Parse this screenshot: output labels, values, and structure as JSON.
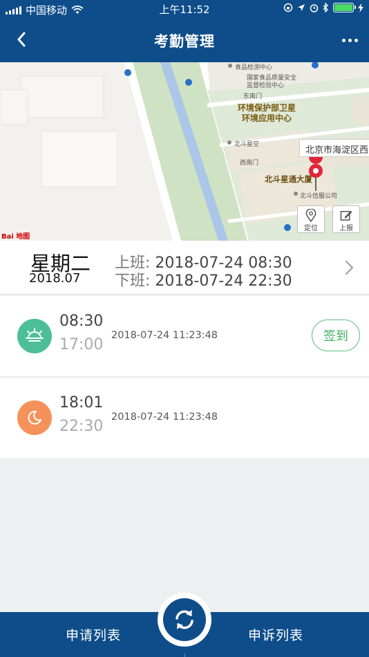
{
  "status_bar": {
    "carrier": "中国移动",
    "time": "上午11:52"
  },
  "header": {
    "title": "考勤管理"
  },
  "map": {
    "labels": {
      "food_center": "食品检测中心",
      "quality_1": "国家食品质量安全",
      "quality_2": "监督检验中心",
      "east_gate": "东南门",
      "satellite_1": "环境保护部卫星",
      "satellite_2": "环境应用中心",
      "beidou_sky": "北斗星空",
      "west_gate": "西南门",
      "building": "北斗星通大厦",
      "service": "北斗信服公司",
      "baidu": "Bai 地图"
    },
    "address": "北京市海淀区西",
    "locate_label": "定位",
    "report_label": "上报"
  },
  "summary": {
    "weekday": "星期二",
    "month": "2018.07",
    "on_duty_label": "上班:",
    "on_duty_time": "2018-07-24 08:30",
    "off_duty_label": "下班:",
    "off_duty_time": "2018-07-24 22:30"
  },
  "shifts": [
    {
      "icon": "sunrise-icon",
      "start": "08:30",
      "end": "17:00",
      "timestamp": "2018-07-24 11:23:48",
      "button": "签到",
      "color": "#4dbf98"
    },
    {
      "icon": "moon-icon",
      "start": "18:01",
      "end": "22:30",
      "timestamp": "2018-07-24 11:23:48",
      "color": "#f4925a"
    }
  ],
  "bottom_bar": {
    "left_tab": "申请列表",
    "right_tab": "申诉列表",
    "center_icon": "refresh-icon"
  }
}
